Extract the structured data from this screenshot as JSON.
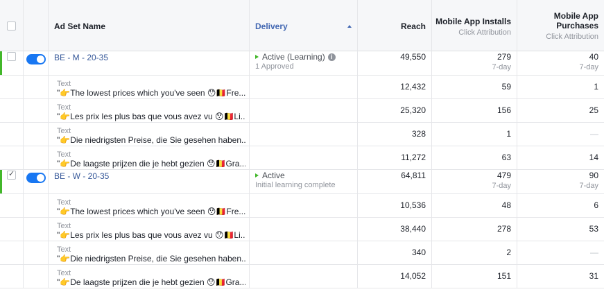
{
  "header": {
    "ad_set_name": "Ad Set Name",
    "delivery": "Delivery",
    "reach": "Reach",
    "installs": "Mobile App Installs",
    "installs_sub": "Click Attribution",
    "purchases": "Mobile App Purchases",
    "purchases_sub": "Click Attribution"
  },
  "groups": [
    {
      "name": "BE - M - 20-35",
      "checked": false,
      "status": "Active (Learning)",
      "status_sub": "1 Approved",
      "reach": "49,550",
      "installs": "279",
      "installs_window": "7-day",
      "purchases": "40",
      "purchases_window": "7-day",
      "ads": [
        {
          "label": "Text",
          "text": "\"👉The lowest prices which you've seen 😯🇧🇪Fre...",
          "reach": "12,432",
          "installs": "59",
          "purchases": "1"
        },
        {
          "label": "Text",
          "text": "\"👉Les prix les plus bas que vous avez vu 😯🇧🇪Li...",
          "reach": "25,320",
          "installs": "156",
          "purchases": "25"
        },
        {
          "label": "Text",
          "text": "\"👉Die niedrigsten Preise, die Sie gesehen haben...",
          "reach": "328",
          "installs": "1",
          "purchases": "—"
        },
        {
          "label": "Text",
          "text": "\"👉De laagste prijzen die je hebt gezien 😯🇧🇪Gra...",
          "reach": "11,272",
          "installs": "63",
          "purchases": "14"
        }
      ]
    },
    {
      "name": "BE - W - 20-35",
      "checked": true,
      "status": "Active",
      "status_sub": "Initial learning complete",
      "reach": "64,811",
      "installs": "479",
      "installs_window": "7-day",
      "purchases": "90",
      "purchases_window": "7-day",
      "ads": [
        {
          "label": "Text",
          "text": "\"👉The lowest prices which you've seen 😯🇧🇪Fre...",
          "reach": "10,536",
          "installs": "48",
          "purchases": "6"
        },
        {
          "label": "Text",
          "text": "\"👉Les prix les plus bas que vous avez vu 😯🇧🇪Li...",
          "reach": "38,440",
          "installs": "278",
          "purchases": "53"
        },
        {
          "label": "Text",
          "text": "\"👉Die niedrigsten Preise, die Sie gesehen haben...",
          "reach": "340",
          "installs": "2",
          "purchases": "—"
        },
        {
          "label": "Text",
          "text": "\"👉De laagste prijzen die je hebt gezien 😯🇧🇪Gra...",
          "reach": "14,052",
          "installs": "151",
          "purchases": "31"
        }
      ]
    }
  ]
}
